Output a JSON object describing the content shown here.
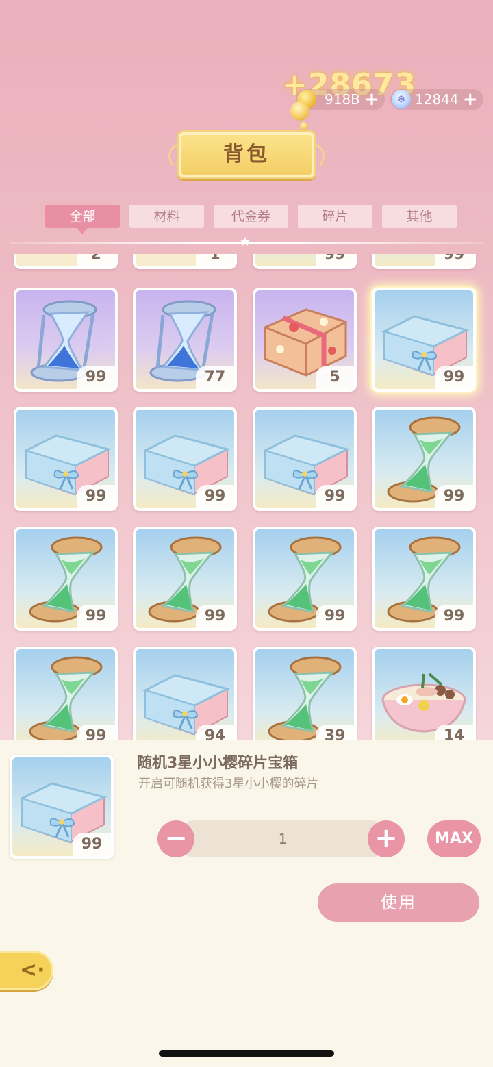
{
  "header": {
    "reward_popup": "+28673",
    "gold_amount": "918B",
    "gem_amount": "12844",
    "plus_symbol": "+",
    "title": "背包"
  },
  "tabs": [
    {
      "label": "全部",
      "active": true
    },
    {
      "label": "材料",
      "active": false
    },
    {
      "label": "代金券",
      "active": false
    },
    {
      "label": "碎片",
      "active": false
    },
    {
      "label": "其他",
      "active": false
    }
  ],
  "grid": {
    "partial_row": [
      {
        "count": "2"
      },
      {
        "count": "1"
      },
      {
        "count": "99"
      },
      {
        "count": "99"
      }
    ],
    "rows": [
      [
        {
          "item": "hourglass-blue",
          "count": "99"
        },
        {
          "item": "hourglass-blue",
          "count": "77"
        },
        {
          "item": "bento-box",
          "count": "5"
        },
        {
          "item": "gift-box",
          "count": "99",
          "selected": true
        }
      ],
      [
        {
          "item": "gift-box",
          "count": "99"
        },
        {
          "item": "gift-box",
          "count": "99"
        },
        {
          "item": "gift-box",
          "count": "99"
        },
        {
          "item": "hourglass-green",
          "count": "99"
        }
      ],
      [
        {
          "item": "hourglass-green",
          "count": "99"
        },
        {
          "item": "hourglass-green",
          "count": "99"
        },
        {
          "item": "hourglass-green",
          "count": "99"
        },
        {
          "item": "hourglass-green",
          "count": "99"
        }
      ],
      [
        {
          "item": "hourglass-green",
          "count": "99"
        },
        {
          "item": "gift-box",
          "count": "94"
        },
        {
          "item": "hourglass-green",
          "count": "39"
        },
        {
          "item": "ramen-bowl",
          "count": "14"
        }
      ]
    ]
  },
  "detail": {
    "name": "随机3星小小樱碎片宝箱",
    "description": "开启可随机获得3星小小樱的碎片",
    "count": "99",
    "quantity": "1",
    "minus_label": "−",
    "plus_label": "+",
    "max_label": "MAX",
    "use_label": "使用"
  },
  "colors": {
    "accent_pink": "#e995a6",
    "tab_active": "#e98fa3",
    "plaque_gold": "#f4cd63"
  }
}
